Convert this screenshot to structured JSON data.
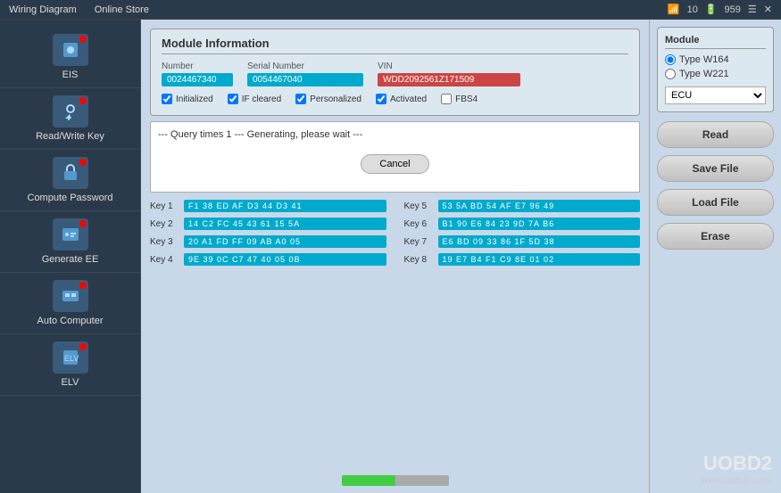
{
  "topbar": {
    "tabs": [
      "Wiring Diagram",
      "Online Store"
    ],
    "signal": "10",
    "battery": "959"
  },
  "sidebar": {
    "items": [
      {
        "label": "EIS",
        "icon": "eis"
      },
      {
        "label": "Read/Write Key",
        "icon": "key"
      },
      {
        "label": "Compute Password",
        "icon": "password"
      },
      {
        "label": "Generate EE",
        "icon": "ee"
      },
      {
        "label": "Auto Computer",
        "icon": "auto"
      },
      {
        "label": "ELV",
        "icon": "elv"
      }
    ]
  },
  "module_info": {
    "title": "Module Information",
    "number_label": "Number",
    "number_value": "0024467340",
    "serial_label": "Serial Number",
    "serial_value": "0054467040",
    "vin_label": "VIN",
    "vin_value": "WDD2092561Z171509",
    "checkboxes": [
      {
        "label": "Initialized",
        "checked": true
      },
      {
        "label": "IF cleared",
        "checked": true
      },
      {
        "label": "Personalized",
        "checked": true
      },
      {
        "label": "Activated",
        "checked": true
      },
      {
        "label": "FBS4",
        "checked": false
      }
    ]
  },
  "console": {
    "lines": [
      "--- Query times 1 --- Generating, please wait ---"
    ],
    "cancel_btn": "Cancel"
  },
  "keys": [
    {
      "label": "Key 1",
      "value": "F1 38 ED AF D3 44 D3 41"
    },
    {
      "label": "Key 2",
      "value": "14 C2 FC 45 43 61 15 5A"
    },
    {
      "label": "Key 3",
      "value": "20 A1 FD FF 09 AB A0 05"
    },
    {
      "label": "Key 4",
      "value": "9E 39 0C C7 47 40 05 0B"
    },
    {
      "label": "Key 5",
      "value": "53 5A BD 54 AF E7 96 49"
    },
    {
      "label": "Key 6",
      "value": "B1 90 E6 84 23 9D 7A B6"
    },
    {
      "label": "Key 7",
      "value": "E6 BD 09 33 86 1F 5D 38"
    },
    {
      "label": "Key 8",
      "value": "19 E7 B4 F1 C9 8E 01 02"
    }
  ],
  "module_panel": {
    "title": "Module",
    "type_w164": "Type W164",
    "type_w221": "Type W221",
    "ecu_label": "ECU",
    "ecu_options": [
      "ECU"
    ]
  },
  "buttons": {
    "read": "Read",
    "save_file": "Save File",
    "load_file": "Load File",
    "erase": "Erase"
  },
  "progress": {
    "percent": 50
  },
  "watermark": {
    "main": "UOBD2",
    "sub": "www.uobdii.com"
  }
}
